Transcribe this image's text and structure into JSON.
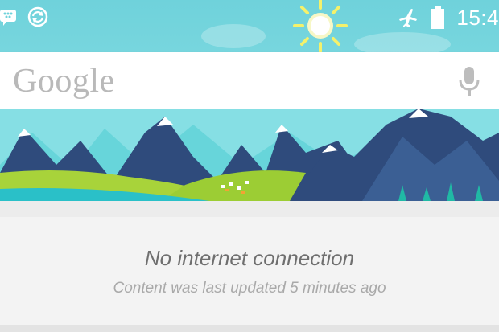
{
  "status_bar": {
    "time": "15:4",
    "icons": [
      "bbm-icon",
      "sync-icon",
      "airplane-mode-icon",
      "battery-icon"
    ]
  },
  "header": {
    "sun": "sun-icon"
  },
  "search": {
    "logo_text": "Google",
    "mic_icon": "microphone-icon"
  },
  "card": {
    "title": "No internet connection",
    "subtitle": "Content was last updated 5 minutes ago"
  },
  "colors": {
    "sky": "#7fdce2",
    "mountain_dark": "#2f4b7c",
    "grass": "#a8d33a",
    "snow": "#ffffff"
  }
}
